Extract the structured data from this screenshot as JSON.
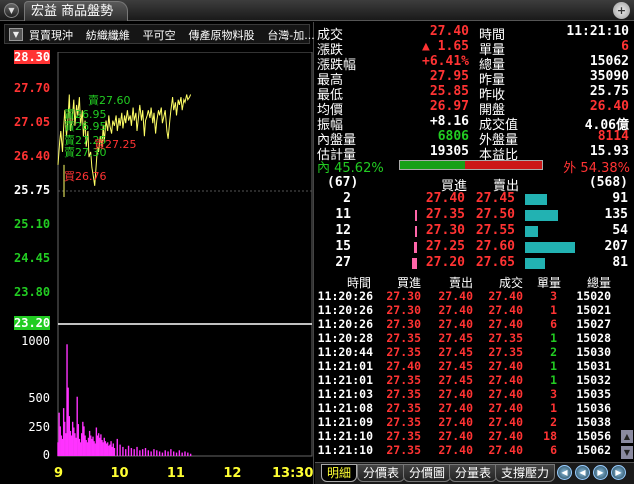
{
  "window": {
    "title": "宏益 商品盤勢",
    "zoom_icon": "magnifier-icon"
  },
  "category_bar": {
    "items": [
      "買賣現沖",
      "紡織纖維",
      "平可空",
      "傳產原物料股",
      "台灣-加..."
    ]
  },
  "chart_data": {
    "type": "line",
    "price_axis": {
      "ticks": [
        "28.30",
        "27.70",
        "27.05",
        "26.40",
        "25.75",
        "25.10",
        "24.45",
        "23.80",
        "23.20"
      ],
      "tick_values": [
        28.3,
        27.7,
        27.05,
        26.4,
        25.75,
        25.1,
        24.45,
        23.8,
        23.2
      ],
      "top_label_color": "#ff3333",
      "bottom_label_color": "#22cc22",
      "ylim": [
        23.2,
        28.3
      ]
    },
    "volume_axis": {
      "ticks": [
        "1000",
        "500",
        "250",
        "0"
      ],
      "tick_values": [
        1000,
        500,
        250,
        0
      ],
      "ylim": [
        0,
        1000
      ]
    },
    "x_ticks": [
      "9",
      "10",
      "11",
      "12",
      "13:30"
    ],
    "x_tick_times": [
      9.0,
      10.0,
      11.0,
      12.0,
      13.5
    ],
    "reference_price": 25.75,
    "price_series": {
      "color": "#ffff66",
      "x": [
        9.0,
        9.03,
        9.05,
        9.08,
        9.1,
        9.12,
        9.15,
        9.18,
        9.2,
        9.22,
        9.25,
        9.28,
        9.3,
        9.33,
        9.35,
        9.38,
        9.4,
        9.43,
        9.45,
        9.48,
        9.5,
        9.53,
        9.55,
        9.58,
        9.6,
        9.63,
        9.65,
        9.68,
        9.7,
        9.72,
        9.75,
        9.78,
        9.8,
        9.82,
        9.85,
        9.88,
        9.9,
        9.92,
        9.95,
        9.97,
        10.0,
        10.03,
        10.05,
        10.08,
        10.1,
        10.13,
        10.15,
        10.18,
        10.2,
        10.23,
        10.25,
        10.28,
        10.3,
        10.33,
        10.35,
        10.38,
        10.4,
        10.43,
        10.45,
        10.48,
        10.5,
        10.53,
        10.55,
        10.58,
        10.6,
        10.63,
        10.65,
        10.68,
        10.7,
        10.73,
        10.75,
        10.78,
        10.8,
        10.83,
        10.85,
        10.88,
        10.9,
        10.93,
        10.95,
        10.98,
        11.0,
        11.03,
        11.05,
        11.08,
        11.1,
        11.13,
        11.15,
        11.18,
        11.2,
        11.23,
        11.25,
        11.28,
        11.3,
        11.33,
        11.35
      ],
      "y": [
        26.25,
        26.7,
        26.9,
        26.5,
        26.95,
        27.3,
        26.8,
        27.2,
        27.6,
        26.9,
        27.1,
        27.5,
        27.0,
        27.4,
        27.2,
        27.55,
        27.0,
        27.3,
        26.8,
        27.1,
        26.6,
        26.9,
        26.4,
        26.5,
        26.2,
        26.0,
        25.85,
        26.3,
        26.6,
        26.5,
        26.8,
        26.6,
        27.0,
        26.7,
        27.1,
        26.9,
        27.2,
        27.0,
        26.85,
        27.1,
        27.0,
        27.2,
        26.9,
        27.15,
        27.0,
        27.25,
        26.95,
        27.2,
        27.05,
        27.3,
        27.1,
        27.2,
        27.0,
        27.35,
        27.1,
        27.25,
        26.9,
        27.2,
        27.4,
        27.1,
        27.3,
        26.8,
        27.1,
        27.2,
        27.3,
        27.15,
        27.35,
        27.05,
        27.25,
        26.85,
        27.1,
        27.3,
        27.2,
        27.35,
        27.05,
        27.2,
        27.3,
        26.9,
        26.75,
        27.1,
        27.3,
        27.55,
        27.3,
        27.45,
        27.2,
        27.5,
        27.4,
        27.55,
        27.3,
        27.5,
        27.45,
        27.6,
        27.5,
        27.55,
        27.6
      ]
    },
    "bid_ask_overlay": {
      "labels": [
        "賣27.60",
        "賣26.95",
        "賣26.95",
        "賣27.25",
        "賣27.30",
        "買27.25",
        "買26.76"
      ],
      "values": [
        27.6,
        26.95,
        26.95,
        27.25,
        27.3,
        27.25,
        26.76
      ],
      "colors": [
        "#22cc22",
        "#22cc22",
        "#22cc22",
        "#22cc22",
        "#22cc22",
        "#ff3333",
        "#ff3333"
      ]
    },
    "volume_series": {
      "color": "#ff33ff",
      "x": [
        9.0,
        9.02,
        9.04,
        9.06,
        9.08,
        9.1,
        9.12,
        9.14,
        9.16,
        9.18,
        9.2,
        9.22,
        9.24,
        9.26,
        9.28,
        9.3,
        9.32,
        9.34,
        9.36,
        9.38,
        9.4,
        9.42,
        9.44,
        9.46,
        9.48,
        9.5,
        9.52,
        9.54,
        9.56,
        9.58,
        9.6,
        9.62,
        9.64,
        9.66,
        9.68,
        9.7,
        9.72,
        9.74,
        9.76,
        9.78,
        9.8,
        9.82,
        9.84,
        9.86,
        9.88,
        9.9,
        9.92,
        9.94,
        9.96,
        9.98,
        10.0,
        10.05,
        10.1,
        10.15,
        10.2,
        10.25,
        10.3,
        10.35,
        10.4,
        10.45,
        10.5,
        10.55,
        10.6,
        10.65,
        10.7,
        10.75,
        10.8,
        10.85,
        10.9,
        10.95,
        11.0,
        11.05,
        11.1,
        11.15,
        11.2,
        11.25,
        11.3,
        11.35
      ],
      "values": [
        120,
        380,
        260,
        180,
        150,
        420,
        300,
        200,
        980,
        600,
        350,
        220,
        180,
        300,
        250,
        200,
        160,
        520,
        280,
        150,
        120,
        200,
        300,
        260,
        180,
        140,
        120,
        160,
        220,
        180,
        150,
        170,
        130,
        110,
        250,
        180,
        200,
        160,
        190,
        140,
        120,
        160,
        130,
        110,
        120,
        90,
        100,
        130,
        80,
        110,
        70,
        150,
        100,
        80,
        60,
        90,
        70,
        60,
        80,
        50,
        60,
        70,
        50,
        40,
        60,
        50,
        40,
        30,
        50,
        40,
        60,
        40,
        30,
        50,
        30,
        40,
        30,
        20
      ]
    },
    "current_line_color": "#ffffff"
  },
  "quote": {
    "rows": [
      {
        "l_label": "成交",
        "l_value": "27.40",
        "l_color": "#ff3333",
        "r_label": "時間",
        "r_value": "11:21:10",
        "r_color": "#ffffff"
      },
      {
        "l_label": "漲跌",
        "l_value": "▲ 1.65",
        "l_color": "#ff3333",
        "r_label": "單量",
        "r_value": "6",
        "r_color": "#ff3333"
      },
      {
        "l_label": "漲跌幅",
        "l_value": "+6.41%",
        "l_color": "#ff3333",
        "r_label": "總量",
        "r_value": "15062",
        "r_color": "#ffffff"
      },
      {
        "l_label": "最高",
        "l_value": "27.95",
        "l_color": "#ff3333",
        "r_label": "昨量",
        "r_value": "35090",
        "r_color": "#ffffff"
      },
      {
        "l_label": "最低",
        "l_value": "25.85",
        "l_color": "#ff3333",
        "r_label": "昨收",
        "r_value": "25.75",
        "r_color": "#ffffff"
      },
      {
        "l_label": "均價",
        "l_value": "26.97",
        "l_color": "#ff3333",
        "r_label": "開盤",
        "r_value": "26.40",
        "r_color": "#ff3333"
      },
      {
        "l_label": "振幅",
        "l_value": "+8.16",
        "l_color": "#ffffff",
        "r_label": "成交值",
        "r_value": "4.06億",
        "r_color": "#ffffff"
      },
      {
        "l_label": "內盤量",
        "l_value": "6806",
        "l_color": "#22cc22",
        "r_label": "外盤量",
        "r_value": "8114",
        "r_color": "#ff3333"
      },
      {
        "l_label": "估計量",
        "l_value": "19305",
        "l_color": "#ffffff",
        "r_label": "本益比",
        "r_value": "15.93",
        "r_color": "#ffffff"
      }
    ]
  },
  "inout": {
    "in_label": "內 45.62%",
    "out_label": "外 54.38%",
    "in_ratio": 0.4562,
    "out_ratio": 0.5438
  },
  "order_book": {
    "bid_total": "(67)",
    "ask_total": "(568)",
    "header_bid": "買進",
    "header_ask": "賣出",
    "rows": [
      {
        "bid_qty": "2",
        "bid_price": "27.40",
        "ask_price": "27.45",
        "ask_qty": "91",
        "bid_bar": 0.0,
        "ask_bar": 0.44
      },
      {
        "bid_qty": "11",
        "bid_price": "27.35",
        "ask_price": "27.50",
        "ask_qty": "135",
        "bid_bar": 0.05,
        "ask_bar": 0.65
      },
      {
        "bid_qty": "12",
        "bid_price": "27.30",
        "ask_price": "27.55",
        "ask_qty": "54",
        "bid_bar": 0.06,
        "ask_bar": 0.26
      },
      {
        "bid_qty": "15",
        "bid_price": "27.25",
        "ask_price": "27.60",
        "ask_qty": "207",
        "bid_bar": 0.07,
        "ask_bar": 1.0
      },
      {
        "bid_qty": "27",
        "bid_price": "27.20",
        "ask_price": "27.65",
        "ask_qty": "81",
        "bid_bar": 0.13,
        "ask_bar": 0.39
      }
    ]
  },
  "ticks": {
    "headers": [
      "時間",
      "買進",
      "賣出",
      "成交",
      "單量",
      "總量"
    ],
    "rows": [
      {
        "time": "11:20:26",
        "bid": "27.30",
        "ask": "27.40",
        "deal": "27.40",
        "vol": "3",
        "total": "15020",
        "vol_color": "#ff3333"
      },
      {
        "time": "11:20:26",
        "bid": "27.30",
        "ask": "27.40",
        "deal": "27.40",
        "vol": "1",
        "total": "15021",
        "vol_color": "#ff3333"
      },
      {
        "time": "11:20:26",
        "bid": "27.30",
        "ask": "27.40",
        "deal": "27.40",
        "vol": "6",
        "total": "15027",
        "vol_color": "#ff3333"
      },
      {
        "time": "11:20:28",
        "bid": "27.35",
        "ask": "27.45",
        "deal": "27.35",
        "vol": "1",
        "total": "15028",
        "vol_color": "#22cc22"
      },
      {
        "time": "11:20:44",
        "bid": "27.35",
        "ask": "27.45",
        "deal": "27.35",
        "vol": "2",
        "total": "15030",
        "vol_color": "#22cc22"
      },
      {
        "time": "11:21:01",
        "bid": "27.40",
        "ask": "27.45",
        "deal": "27.40",
        "vol": "1",
        "total": "15031",
        "vol_color": "#22cc22"
      },
      {
        "time": "11:21:01",
        "bid": "27.35",
        "ask": "27.45",
        "deal": "27.40",
        "vol": "1",
        "total": "15032",
        "vol_color": "#22cc22"
      },
      {
        "time": "11:21:03",
        "bid": "27.35",
        "ask": "27.40",
        "deal": "27.40",
        "vol": "3",
        "total": "15035",
        "vol_color": "#ff3333"
      },
      {
        "time": "11:21:08",
        "bid": "27.35",
        "ask": "27.40",
        "deal": "27.40",
        "vol": "1",
        "total": "15036",
        "vol_color": "#ff3333"
      },
      {
        "time": "11:21:09",
        "bid": "27.35",
        "ask": "27.40",
        "deal": "27.40",
        "vol": "2",
        "total": "15038",
        "vol_color": "#ff3333"
      },
      {
        "time": "11:21:10",
        "bid": "27.35",
        "ask": "27.40",
        "deal": "27.40",
        "vol": "18",
        "total": "15056",
        "vol_color": "#ff3333"
      },
      {
        "time": "11:21:10",
        "bid": "27.35",
        "ask": "27.40",
        "deal": "27.40",
        "vol": "6",
        "total": "15062",
        "vol_color": "#ff3333"
      }
    ]
  },
  "bottom_tabs": {
    "tabs": [
      "明細",
      "分價表",
      "分價圖",
      "分量表",
      "支撐壓力"
    ],
    "active": "明細"
  }
}
